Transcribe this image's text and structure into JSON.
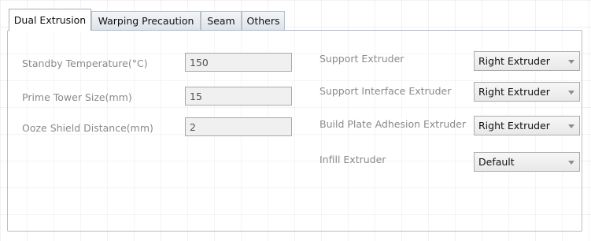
{
  "tabs": [
    {
      "label": "Dual Extrusion",
      "active": true
    },
    {
      "label": "Warping Precaution",
      "active": false
    },
    {
      "label": "Seam",
      "active": false
    },
    {
      "label": "Others",
      "active": false
    }
  ],
  "left_fields": [
    {
      "label": "Standby Temperature(°C)",
      "value": "150"
    },
    {
      "label": "Prime Tower Size(mm)",
      "value": "15"
    },
    {
      "label": "Ooze Shield Distance(mm)",
      "value": "2"
    }
  ],
  "right_fields": [
    {
      "label": "Support Extruder",
      "value": "Right Extruder"
    },
    {
      "label": "Support Interface Extruder",
      "value": "Right Extruder"
    },
    {
      "label": "Build Plate Adhesion Extruder",
      "value": "Right Extruder"
    },
    {
      "label": "Infill Extruder",
      "value": "Default"
    }
  ]
}
